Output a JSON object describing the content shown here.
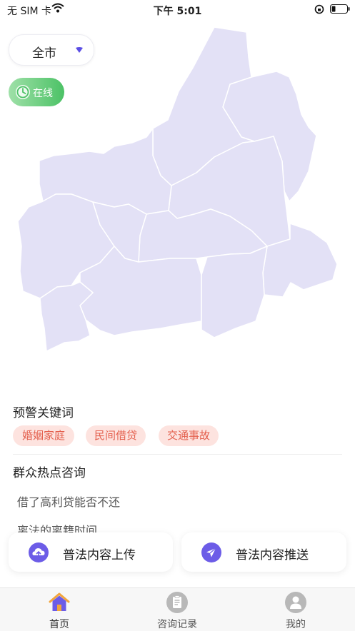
{
  "status_bar": {
    "carrier": "无 SIM 卡",
    "time": "下午 5:01",
    "icons": [
      "wifi-icon",
      "orientation-lock-icon",
      "battery-icon"
    ]
  },
  "city_selector": {
    "label": "全市",
    "icon": "chevron-down-icon"
  },
  "online_badge": {
    "label": "在线",
    "icon": "clock-icon",
    "colors": [
      "#9fe0a8",
      "#4cc266"
    ]
  },
  "map": {
    "fill_color": "#e3e1f6",
    "border_color": "#ffffff"
  },
  "warning_keywords": {
    "title": "预警关键词",
    "tags": [
      "婚姻家庭",
      "民间借贷",
      "交通事故"
    ],
    "tag_color": "#e4604e",
    "tag_background": "#fde3df"
  },
  "hot_consultations": {
    "title": "群众热点咨询",
    "items": [
      "借了高利贷能否不还",
      "离法的离籍时间"
    ]
  },
  "actions": {
    "upload": {
      "label": "普法内容上传",
      "icon": "cloud-upload-icon"
    },
    "push": {
      "label": "普法内容推送",
      "icon": "send-icon"
    },
    "accent": "#6c5ce7"
  },
  "tab_bar": {
    "items": [
      {
        "label": "首页",
        "icon": "home-icon",
        "active": true
      },
      {
        "label": "咨询记录",
        "icon": "clipboard-icon",
        "active": false
      },
      {
        "label": "我的",
        "icon": "profile-icon",
        "active": false
      }
    ]
  }
}
